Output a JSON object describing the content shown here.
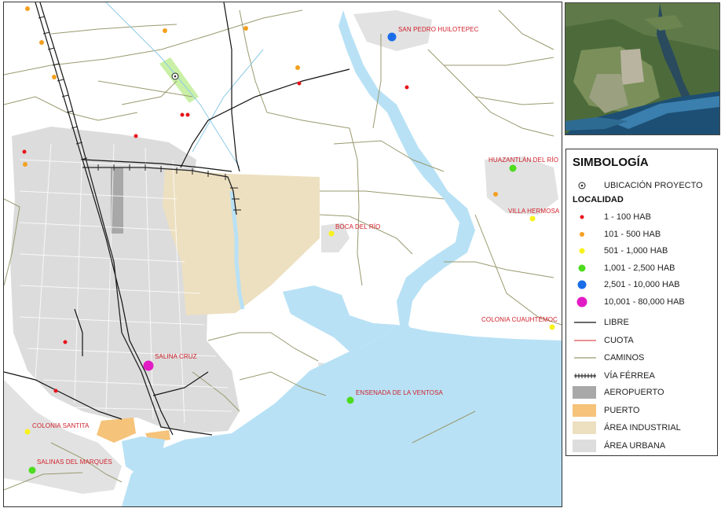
{
  "map": {
    "places": [
      {
        "name": "SAN PEDRO HUILOTEPEC",
        "cls": "2501-10000"
      },
      {
        "name": "HUAZANTLÁN DEL RÍO",
        "cls": "1001-2500"
      },
      {
        "name": "VILLA HERMOSA",
        "cls": "501-1000"
      },
      {
        "name": "BOCA DEL RÍO",
        "cls": "501-1000"
      },
      {
        "name": "COLONIA CUAUHTÉMOC",
        "cls": "501-1000"
      },
      {
        "name": "SALINA CRUZ",
        "cls": "10001-80000"
      },
      {
        "name": "ENSENADA DE LA VENTOSA",
        "cls": "1001-2500"
      },
      {
        "name": "COLONIA SANTITA",
        "cls": "501-1000"
      },
      {
        "name": "SALINAS DEL MARQUÉS",
        "cls": "1001-2500"
      }
    ]
  },
  "legend": {
    "title": "SIMBOLOGÍA",
    "project_label": "UBICACIÓN PROYECTO",
    "locality_heading": "LOCALIDAD",
    "localities": [
      {
        "label": "1 - 100 HAB",
        "color": "#e8141a"
      },
      {
        "label": "101 - 500 HAB",
        "color": "#f5a020"
      },
      {
        "label": "501 - 1,000 HAB",
        "color": "#f8f21c"
      },
      {
        "label": "1,001 - 2,500 HAB",
        "color": "#4ddc1e"
      },
      {
        "label": "2,501 - 10,000 HAB",
        "color": "#1a6de8"
      },
      {
        "label": "10,001 - 80,000 HAB",
        "color": "#e21cc4"
      }
    ],
    "lines": [
      {
        "label": "LIBRE",
        "color": "#111111",
        "style": "solid"
      },
      {
        "label": "CUOTA",
        "color": "#e05050",
        "style": "solid"
      },
      {
        "label": "CAMINOS",
        "color": "#9a9a70",
        "style": "solid"
      },
      {
        "label": "VÍA FÉRREA",
        "color": "#222222",
        "style": "rail"
      }
    ],
    "areas": [
      {
        "label": "AEROPUERTO",
        "color": "#a8a8a8"
      },
      {
        "label": "PUERTO",
        "color": "#f5c37a"
      },
      {
        "label": "ÁREA INDUSTRIAL",
        "color": "#ede0c0"
      },
      {
        "label": "ÁREA URBANA",
        "color": "#dddddd"
      }
    ]
  },
  "colors": {
    "water": "#b8e1f5",
    "urban": "#dcdcdc",
    "industrial": "#ede0c0",
    "port": "#f5c37a",
    "airport": "#a8a8a8",
    "project": "#c9f0a6",
    "roads": "#9a9a70"
  }
}
